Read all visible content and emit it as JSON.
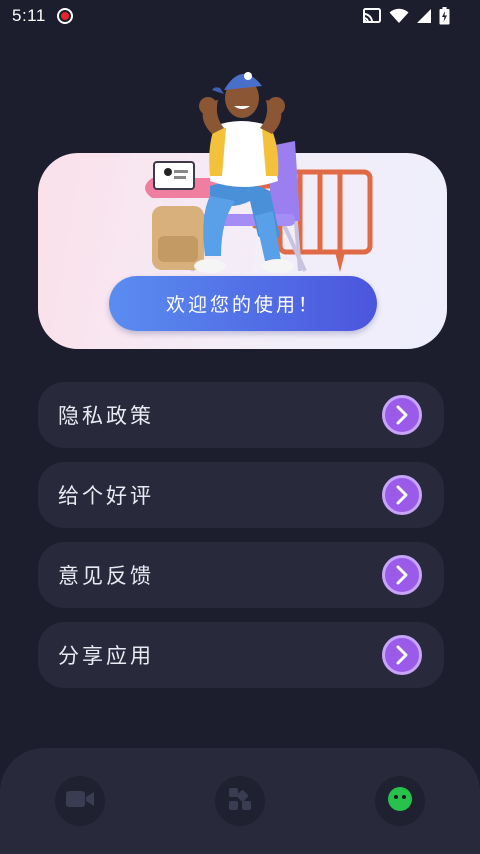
{
  "status_bar": {
    "time": "5:11",
    "icons": [
      "record-icon",
      "cast-icon",
      "wifi-icon",
      "signal-icon",
      "battery-icon"
    ]
  },
  "hero": {
    "welcome_text": "欢迎您的使用！"
  },
  "menu": {
    "items": [
      {
        "label": "隐私政策",
        "icon": "chevron-right-icon"
      },
      {
        "label": "给个好评",
        "icon": "chevron-right-icon"
      },
      {
        "label": "意见反馈",
        "icon": "chevron-right-icon"
      },
      {
        "label": "分享应用",
        "icon": "chevron-right-icon"
      }
    ]
  },
  "bottom_nav": {
    "items": [
      {
        "icon": "video-camera-icon",
        "active": false
      },
      {
        "icon": "grid-apps-icon",
        "active": false
      },
      {
        "icon": "smiley-face-icon",
        "active": true
      }
    ]
  },
  "colors": {
    "background": "#1c1d2d",
    "card": "#282a3c",
    "accent_purple": "#9a5ce8",
    "button_gradient_start": "#5a8df0",
    "button_gradient_end": "#4b55dd",
    "active_green": "#27c24c"
  }
}
